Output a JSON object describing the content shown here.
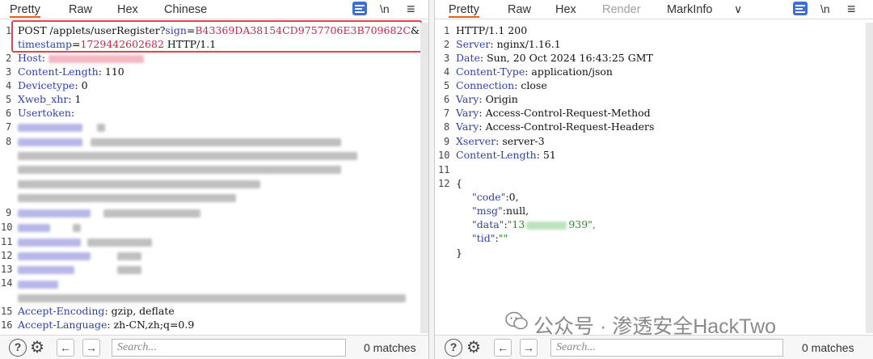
{
  "left_tabs": {
    "pretty": "Pretty",
    "raw": "Raw",
    "hex": "Hex",
    "chinese": "Chinese"
  },
  "right_tabs": {
    "pretty": "Pretty",
    "raw": "Raw",
    "hex": "Hex",
    "render": "Render",
    "markinfo": "MarkInfo"
  },
  "icons": {
    "newline": "\\n",
    "menu": "≡",
    "dropdown": "∨"
  },
  "request": {
    "line1_method_path": "POST /applets/userRegister?",
    "sign_key": "sign",
    "sign_value": "B43369DA38154CD9757706E3B709682C",
    "amp": "&",
    "timestamp_key": "timestamp",
    "timestamp_value": "1729442602682",
    "protocol": " HTTP/1.1",
    "host_key": "Host",
    "content_length_key": "Content-Length",
    "content_length_value": "110",
    "devicetype_key": "Devicetype",
    "devicetype_value": "0",
    "xweb_key": "Xweb_xhr",
    "xweb_value": "1",
    "usertoken_key": "Usertoken",
    "accept_encoding_key": "Accept-Encoding",
    "accept_encoding_value": "gzip, deflate",
    "accept_language_key": "Accept-Language",
    "accept_language_value": "zh-CN,zh;q=0.9"
  },
  "response": {
    "status": "HTTP/1.1 200",
    "server_key": "Server",
    "server_value": "nginx/1.16.1",
    "date_key": "Date",
    "date_value": "Sun, 20 Oct 2024 16:43:25 GMT",
    "content_type_key": "Content-Type",
    "content_type_value": "application/json",
    "connection_key": "Connection",
    "connection_value": "close",
    "vary_key": "Vary",
    "vary1_value": "Origin",
    "vary2_value": "Access-Control-Request-Method",
    "vary3_value": "Access-Control-Request-Headers",
    "xserver_key": "Xserver",
    "xserver_value": "server-3",
    "resp_content_length_key": "Content-Length",
    "resp_content_length_value": "51",
    "brace_open": "{",
    "code_key": "\"code\"",
    "code_value": "0,",
    "msg_key": "\"msg\"",
    "msg_value": "null,",
    "data_key": "\"data\"",
    "data_value_start": "\"13",
    "data_value_end": "939\",",
    "tid_key": "\"tid\"",
    "tid_value": "\"\"",
    "brace_close": "}"
  },
  "search": {
    "placeholder": "Search...",
    "left_matches": "0 matches",
    "right_matches": "0 matches"
  },
  "watermark": {
    "text": "公众号 · 渗透安全HackTwo"
  }
}
